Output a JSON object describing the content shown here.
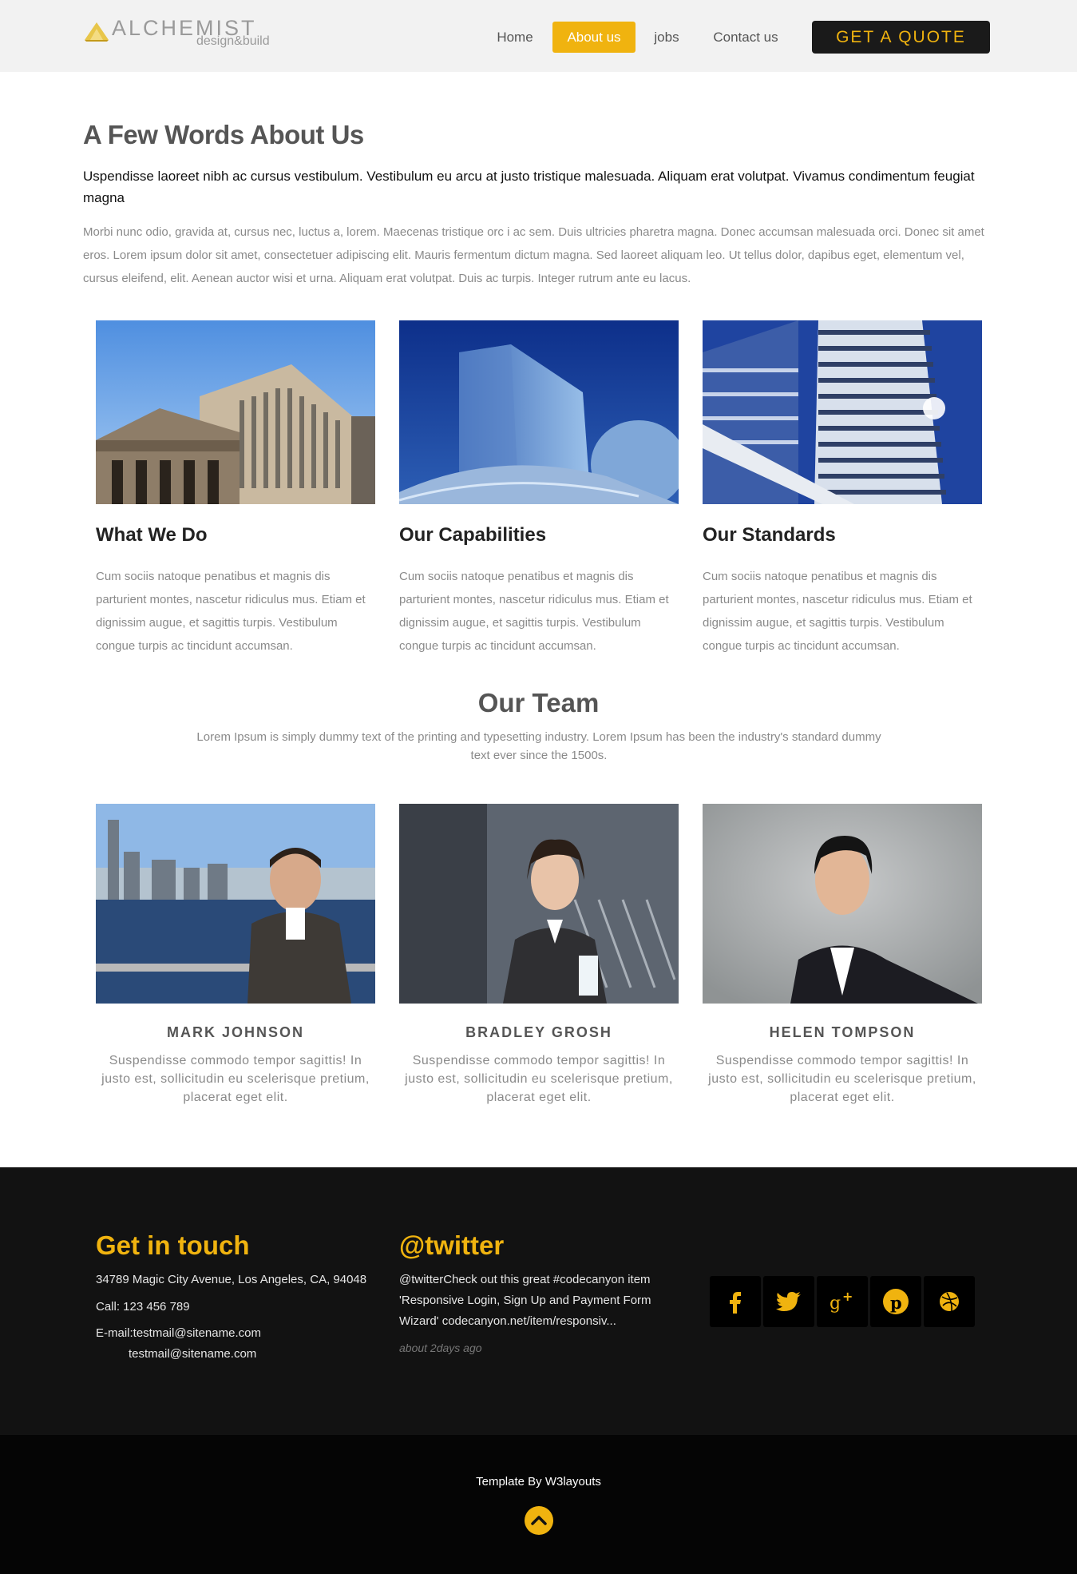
{
  "colors": {
    "accent": "#f0b30f",
    "header_bg": "#f2f2f2",
    "footer_bg": "#121212",
    "bottom_bg": "#050505"
  },
  "logo": {
    "name": "ALCHEMIST",
    "tagline": "design&build"
  },
  "nav": {
    "items": [
      {
        "label": "Home",
        "active": false
      },
      {
        "label": "About us",
        "active": true
      },
      {
        "label": "jobs",
        "active": false
      },
      {
        "label": "Contact us",
        "active": false
      }
    ],
    "cta": "GET A QUOTE"
  },
  "about": {
    "title": "A Few Words About Us",
    "lead": "Uspendisse laoreet nibh ac cursus vestibulum. Vestibulum eu arcu at justo tristique malesuada. Aliquam erat volutpat. Vivamus condimentum feugiat magna",
    "body": "Morbi nunc odio, gravida at, cursus nec, luctus a, lorem. Maecenas tristique orc i ac sem. Duis ultricies pharetra magna. Donec accumsan malesuada orci. Donec sit amet eros. Lorem ipsum dolor sit amet, consectetuer adipiscing elit. Mauris fermentum dictum magna. Sed laoreet aliquam leo. Ut tellus dolor, dapibus eget, elementum vel, cursus eleifend, elit. Aenean auctor wisi et urna. Aliquam erat volutpat. Duis ac turpis. Integer rutrum ante eu lacus."
  },
  "features": [
    {
      "title": "What We Do",
      "text": "Cum sociis natoque penatibus et magnis dis parturient montes, nascetur ridiculus mus. Etiam et dignissim augue, et sagittis turpis. Vestibulum congue turpis ac tincidunt accumsan."
    },
    {
      "title": "Our Capabilities",
      "text": "Cum sociis natoque penatibus et magnis dis parturient montes, nascetur ridiculus mus. Etiam et dignissim augue, et sagittis turpis. Vestibulum congue turpis ac tincidunt accumsan."
    },
    {
      "title": "Our Standards",
      "text": "Cum sociis natoque penatibus et magnis dis parturient montes, nascetur ridiculus mus. Etiam et dignissim augue, et sagittis turpis. Vestibulum congue turpis ac tincidunt accumsan."
    }
  ],
  "team": {
    "title": "Our Team",
    "subtitle": "Lorem Ipsum is simply dummy text of the printing and typesetting industry. Lorem Ipsum has been the industry's standard dummy text ever since the 1500s.",
    "members": [
      {
        "name": "MARK JOHNSON",
        "text": "Suspendisse commodo tempor sagittis! In justo est, sollicitudin eu scelerisque pretium, placerat eget elit."
      },
      {
        "name": "BRADLEY GROSH",
        "text": "Suspendisse commodo tempor sagittis! In justo est, sollicitudin eu scelerisque pretium, placerat eget elit."
      },
      {
        "name": "HELEN TOMPSON",
        "text": "Suspendisse commodo tempor sagittis! In justo est, sollicitudin eu scelerisque pretium, placerat eget elit."
      }
    ]
  },
  "footer": {
    "contact": {
      "title": "Get in touch",
      "address": "34789 Magic City Avenue, Los Angeles, CA, 94048",
      "phone": "Call: 123 456 789",
      "email_label": "E-mail:testmail@sitename.com",
      "email_2": "testmail@sitename.com"
    },
    "twitter": {
      "title": "@twitter",
      "tweet": "@twitterCheck out this great #codecanyon item 'Responsive Login, Sign Up and Payment Form Wizard' codecanyon.net/item/responsiv...",
      "time": "about 2days ago"
    },
    "social": [
      "facebook-icon",
      "twitter-icon",
      "google-plus-icon",
      "pinterest-icon",
      "dribbble-icon"
    ],
    "credit": "Template By W3layouts"
  }
}
